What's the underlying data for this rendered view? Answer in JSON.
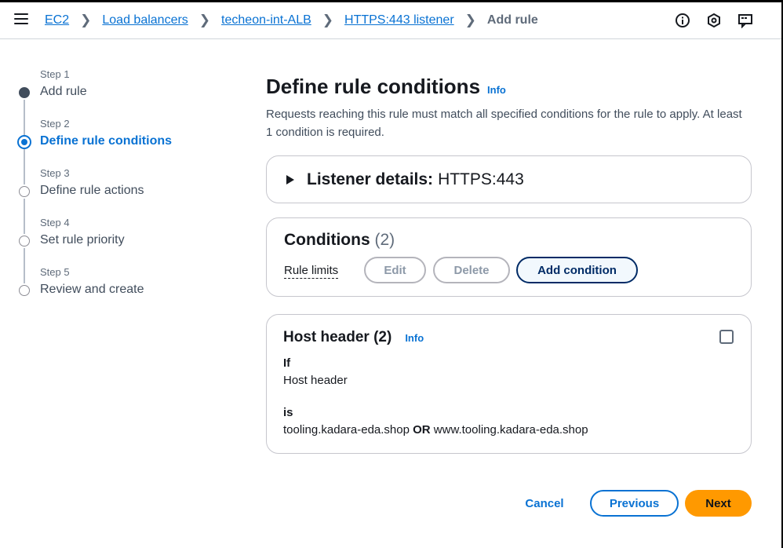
{
  "breadcrumbs": [
    {
      "label": "EC2"
    },
    {
      "label": "Load balancers"
    },
    {
      "label": "techeon-int-ALB"
    },
    {
      "label": "HTTPS:443 listener"
    }
  ],
  "breadcrumb_current": "Add rule",
  "icons": {
    "menu": "menu-icon",
    "info": "info-icon",
    "notifications": "settings-hex-icon",
    "feedback": "feedback-icon"
  },
  "steps": [
    {
      "num": "Step 1",
      "title": "Add rule",
      "state": "done"
    },
    {
      "num": "Step 2",
      "title": "Define rule conditions",
      "state": "current"
    },
    {
      "num": "Step 3",
      "title": "Define rule actions",
      "state": "pending"
    },
    {
      "num": "Step 4",
      "title": "Set rule priority",
      "state": "pending"
    },
    {
      "num": "Step 5",
      "title": "Review and create",
      "state": "pending"
    }
  ],
  "main": {
    "title": "Define rule conditions",
    "info": "Info",
    "description": "Requests reaching this rule must match all specified conditions for the rule to apply. At least 1 condition is required."
  },
  "listener": {
    "label": "Listener details:",
    "value": "HTTPS:443"
  },
  "conditions": {
    "title": "Conditions",
    "count": "(2)",
    "rule_limits": "Rule limits",
    "edit": "Edit",
    "delete": "Delete",
    "add": "Add condition"
  },
  "host_header": {
    "title": "Host header (2)",
    "info": "Info",
    "if_label": "If",
    "if_value": "Host header",
    "is_label": "is",
    "value_1": "tooling.kadara-eda.shop",
    "or": "OR",
    "value_2": "www.tooling.kadara-eda.shop"
  },
  "footer": {
    "cancel": "Cancel",
    "previous": "Previous",
    "next": "Next"
  },
  "colors": {
    "link": "#0972d3",
    "primary_button": "#ff9900",
    "text": "#16191f"
  }
}
